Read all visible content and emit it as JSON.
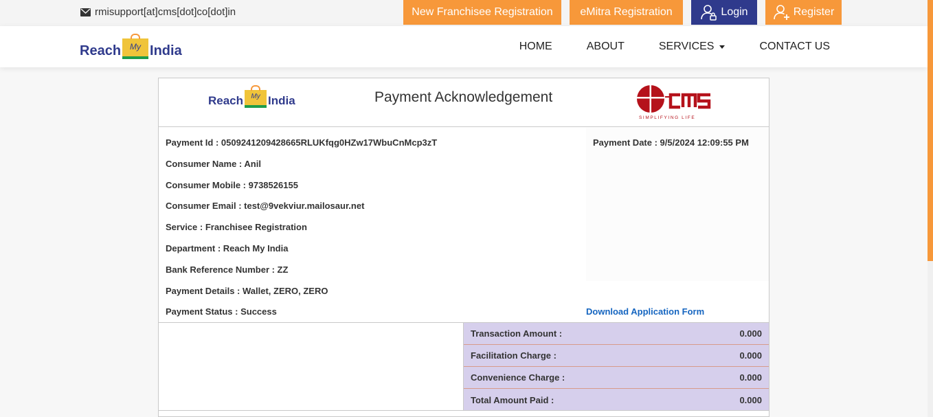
{
  "topbar": {
    "email": "rmisupport[at]cms[dot]co[dot]in",
    "buttons": {
      "franchisee": "New Franchisee Registration",
      "emitra": "eMitra Registration",
      "login": "Login",
      "register": "Register"
    }
  },
  "brand": {
    "part1": "Reach",
    "part2": "My",
    "part3": "India"
  },
  "nav": {
    "home": "HOME",
    "about": "ABOUT",
    "services": "SERVICES",
    "contact": "CONTACT US"
  },
  "receipt": {
    "title": "Payment Acknowledgement",
    "cms_tagline": "SIMPLIFYING LIFE",
    "payment_id": "Payment Id : 0509241209428665RLUKfqg0HZw17WbuCnMcp3zT",
    "payment_date": "Payment Date : 9/5/2024 12:09:55 PM",
    "consumer_name": "Consumer Name : Anil",
    "consumer_mobile": "Consumer Mobile : 9738526155",
    "consumer_email": "Consumer Email : test@9vekviur.mailosaur.net",
    "service": "Service : Franchisee Registration",
    "department": "Department : Reach My India",
    "bank_ref": "Bank Reference Number : ZZ",
    "payment_details": "Payment Details : Wallet, ZERO, ZERO",
    "payment_status": "Payment Status : Success",
    "download_link": "Download Application Form",
    "amounts": [
      {
        "label": "Transaction Amount :",
        "value": "0.000"
      },
      {
        "label": "Facilitation Charge :",
        "value": "0.000"
      },
      {
        "label": "Convenience Charge :",
        "value": "0.000"
      },
      {
        "label": "Total Amount Paid :",
        "value": "0.000"
      }
    ]
  },
  "colors": {
    "orange": "#f7983a",
    "navy": "#2f3a8c",
    "green": "#1e9c4a",
    "cms_red": "#b5121b",
    "amount_bg": "#d6cfec",
    "link": "#1565c0"
  }
}
